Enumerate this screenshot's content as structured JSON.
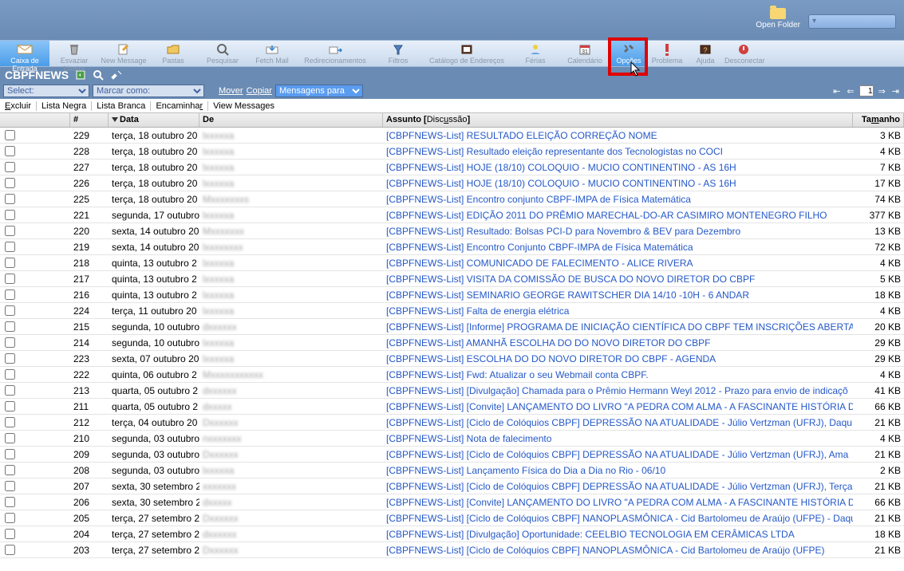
{
  "open_folder_label": "Open Folder",
  "toolbar": [
    {
      "label": "Caixa de Entrada",
      "icon": "inbox"
    },
    {
      "label": "Esvaziar Lixeira",
      "icon": "trash"
    },
    {
      "label": "New Message",
      "icon": "compose"
    },
    {
      "label": "Pastas",
      "icon": "folder"
    },
    {
      "label": "Pesquisar",
      "icon": "search"
    },
    {
      "label": "Fetch Mail",
      "icon": "fetch"
    },
    {
      "label": "Redirecionamentos",
      "icon": "redirect"
    },
    {
      "label": "Filtros",
      "icon": "filter"
    },
    {
      "label": "Catálogo de Endereços",
      "icon": "book"
    },
    {
      "label": "Férias",
      "icon": "vacation"
    },
    {
      "label": "Calendário",
      "icon": "calendar"
    },
    {
      "label": "Opções",
      "icon": "options"
    },
    {
      "label": "Problema",
      "icon": "problem"
    },
    {
      "label": "Ajuda",
      "icon": "help"
    },
    {
      "label": "Desconectar",
      "icon": "logout"
    }
  ],
  "title": "CBPFNEWS",
  "action_bar": {
    "select_label": "Select:",
    "mark_label": "Marcar como:",
    "move": "Mover",
    "copy": "Copiar",
    "messages_to": "Mensagens para",
    "page": "1"
  },
  "sub_actions": {
    "excluir": "Excluir",
    "lista_negra": "Lista Negra",
    "lista_branca": "Lista Branca",
    "encaminhar": "Encaminhar",
    "view_messages": "View Messages"
  },
  "columns": {
    "num": "#",
    "date": "Data",
    "from": "De",
    "subject": "Assunto",
    "discussion": "Discussão",
    "size": "Tamanho"
  },
  "rows": [
    {
      "n": "229",
      "date": "terça, 18 outubro 20",
      "from": "lxxxxxa",
      "subj": "[CBPFNEWS-List] RESULTADO ELEIÇÃO CORREÇÃO NOME",
      "size": "3 KB"
    },
    {
      "n": "228",
      "date": "terça, 18 outubro 20",
      "from": "lxxxxxa",
      "subj": "[CBPFNEWS-List] Resultado eleição representante dos Tecnologistas no COCI",
      "size": "4 KB"
    },
    {
      "n": "227",
      "date": "terça, 18 outubro 20",
      "from": "lxxxxxa",
      "subj": "[CBPFNEWS-List] HOJE (18/10)  COLOQUIO - MUCIO CONTINENTINO - AS 16H",
      "size": "7 KB"
    },
    {
      "n": "226",
      "date": "terça, 18 outubro 20",
      "from": "lxxxxxa",
      "subj": "[CBPFNEWS-List] HOJE (18/10)  COLOQUIO - MUCIO CONTINENTINO - AS 16H",
      "size": "17 KB"
    },
    {
      "n": "225",
      "date": "terça, 18 outubro 20",
      "from": "Mxxxxxxxs",
      "subj": "[CBPFNEWS-List] Encontro conjunto CBPF-IMPA de Física Matemática",
      "size": "74 KB"
    },
    {
      "n": "221",
      "date": "segunda, 17 outubro",
      "from": "lxxxxxa",
      "subj": "[CBPFNEWS-List] EDIÇÃO 2011 DO PRÊMIO MARECHAL-DO-AR CASIMIRO MONTENEGRO FILHO",
      "size": "377 KB"
    },
    {
      "n": "220",
      "date": "sexta, 14 outubro 20",
      "from": "Mxxxxxxx",
      "subj": "[CBPFNEWS-List] Resultado: Bolsas PCI-D para Novembro & BEV para Dezembro",
      "size": "13 KB"
    },
    {
      "n": "219",
      "date": "sexta, 14 outubro 20",
      "from": "lxxxxxxxx",
      "subj": "[CBPFNEWS-List] Encontro Conjunto CBPF-IMPA de Física Matemática",
      "size": "72 KB"
    },
    {
      "n": "218",
      "date": "quinta, 13 outubro 2",
      "from": "lxxxxxa",
      "subj": "[CBPFNEWS-List] COMUNICADO DE FALECIMENTO - ALICE RIVERA",
      "size": "4 KB"
    },
    {
      "n": "217",
      "date": "quinta, 13 outubro 2",
      "from": "lxxxxxa",
      "subj": "[CBPFNEWS-List] VISITA DA COMISSÃO DE BUSCA DO NOVO DIRETOR DO CBPF",
      "size": "5 KB"
    },
    {
      "n": "216",
      "date": "quinta, 13 outubro 2",
      "from": "lxxxxxa",
      "subj": "[CBPFNEWS-List] SEMINARIO GEORGE RAWITSCHER DIA 14/10 -10H - 6 ANDAR",
      "size": "18 KB"
    },
    {
      "n": "224",
      "date": "terça, 11 outubro 20",
      "from": "lxxxxxa",
      "subj": "[CBPFNEWS-List] Falta de energia elétrica",
      "size": "4 KB"
    },
    {
      "n": "215",
      "date": "segunda, 10 outubro",
      "from": "dxxxxxx",
      "subj": "[CBPFNEWS-List] [Informe] PROGRAMA DE INICIAÇÃO CIENTÍFICA DO CBPF TEM INSCRIÇÕES ABERTAS",
      "size": "20 KB"
    },
    {
      "n": "214",
      "date": "segunda, 10 outubro",
      "from": "lxxxxxa",
      "subj": "[CBPFNEWS-List] AMANHÃ ESCOLHA DO DO NOVO DIRETOR DO CBPF",
      "size": "29 KB"
    },
    {
      "n": "223",
      "date": "sexta, 07 outubro 20",
      "from": "lxxxxxa",
      "subj": "[CBPFNEWS-List] ESCOLHA DO DO NOVO DIRETOR DO CBPF -  AGENDA",
      "size": "29 KB"
    },
    {
      "n": "222",
      "date": "quinta, 06 outubro 2",
      "from": "Mxxxxxxxxxxx",
      "subj": "[CBPFNEWS-List] Fwd: Atualizar o seu Webmail conta CBPF.",
      "size": "4 KB"
    },
    {
      "n": "213",
      "date": "quarta, 05 outubro 2",
      "from": "dxxxxxx",
      "subj": "[CBPFNEWS-List] [Divulgação] Chamada para o Prêmio Hermann Weyl 2012 - Prazo para envio de indicaçõ",
      "size": "41 KB"
    },
    {
      "n": "211",
      "date": "quarta, 05 outubro 2",
      "from": "dxxxxx",
      "subj": "[CBPFNEWS-List] [Convite] LANÇAMENTO DO LIVRO \"A PEDRA COM ALMA - A FASCINANTE HISTÓRIA DO",
      "size": "66 KB"
    },
    {
      "n": "212",
      "date": "terça, 04 outubro 20",
      "from": "Dxxxxxx",
      "subj": "[CBPFNEWS-List]  [Ciclo de Colóquios CBPF] DEPRESSÃO NA ATUALIDADE - Júlio Vertzman (UFRJ), Daqu",
      "size": "21 KB"
    },
    {
      "n": "210",
      "date": "segunda, 03 outubro",
      "from": "nxxxxxxx",
      "subj": "[CBPFNEWS-List] Nota de falecimento",
      "size": "4 KB"
    },
    {
      "n": "209",
      "date": "segunda, 03 outubro",
      "from": "Dxxxxxx",
      "subj": "[CBPFNEWS-List]  [Ciclo de Colóquios CBPF] DEPRESSÃO NA ATUALIDADE - Júlio Vertzman (UFRJ), Ama",
      "size": "21 KB"
    },
    {
      "n": "208",
      "date": "segunda, 03 outubro",
      "from": "lxxxxxa",
      "subj": "[CBPFNEWS-List] Lançamento Física do Dia a Dia no Rio - 06/10",
      "size": "2 KB"
    },
    {
      "n": "207",
      "date": "sexta, 30 setembro 2",
      "from": "xxxxxxx",
      "subj": "[CBPFNEWS-List]  [Ciclo de Colóquios CBPF] DEPRESSÃO NA ATUALIDADE - Júlio Vertzman (UFRJ), Terça",
      "size": "21 KB"
    },
    {
      "n": "206",
      "date": "sexta, 30 setembro 2",
      "from": "dxxxxx",
      "subj": "[CBPFNEWS-List] [Convite] LANÇAMENTO DO LIVRO \"A PEDRA COM ALMA - A FASCINANTE HISTÓRIA DO",
      "size": "66 KB"
    },
    {
      "n": "205",
      "date": "terça, 27 setembro 2",
      "from": "Dxxxxxx",
      "subj": "[CBPFNEWS-List] [Ciclo de Colóquios CBPF] NANOPLASMÔNICA - Cid Bartolomeu de Araújo (UFPE) - Daqu",
      "size": "21 KB"
    },
    {
      "n": "204",
      "date": "terça, 27 setembro 2",
      "from": "dxxxxxx",
      "subj": "[CBPFNEWS-List] [Divulgação] Oportunidade: CEELBIO TECNOLOGIA EM CERÂMICAS LTDA",
      "size": "18 KB"
    },
    {
      "n": "203",
      "date": "terça, 27 setembro 2",
      "from": "Dxxxxxx",
      "subj": "[CBPFNEWS-List] [Ciclo de Colóquios CBPF] NANOPLASMÔNICA - Cid Bartolomeu de Araújo (UFPE)",
      "size": "21 KB"
    }
  ]
}
